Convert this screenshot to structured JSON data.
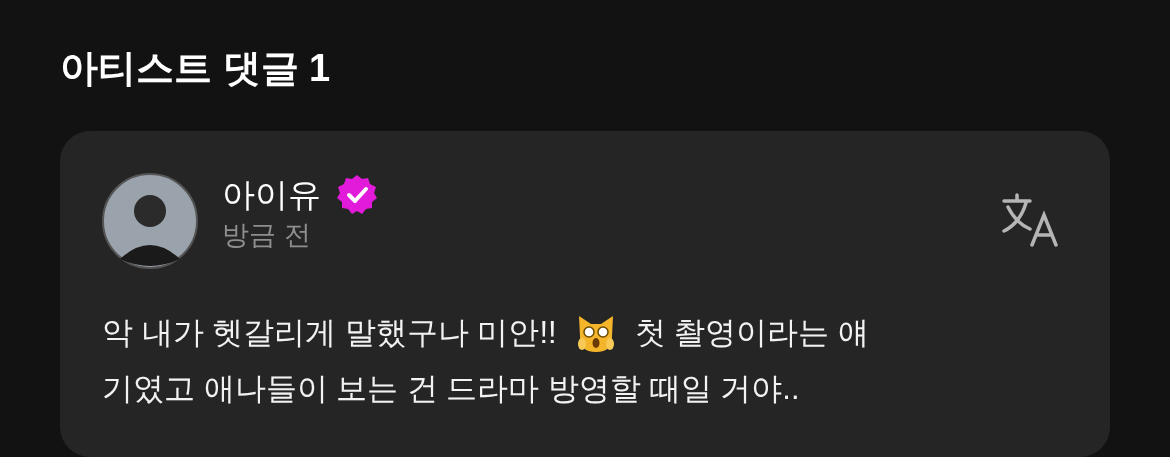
{
  "section_title": "아티스트 댓글 1",
  "comment": {
    "author": "아이유",
    "verified": true,
    "time": "방금 전",
    "text_parts": [
      "악 내가 헷갈리게 말했구나 미안!!",
      "첫 촬영이라는 얘",
      "기였고 애나들이 보는 건 드라마 방영할 때일 거야.."
    ]
  }
}
